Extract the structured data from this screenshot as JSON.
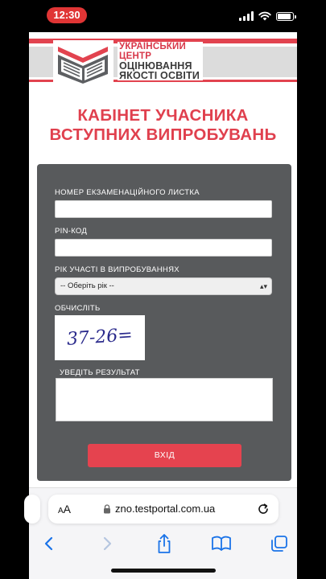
{
  "status_bar": {
    "time": "12:30"
  },
  "logo": {
    "line1": "УКРАЇНСЬКИЙ",
    "line2": "ЦЕНТР",
    "line3": "ОЦІНЮВАННЯ",
    "line4": "ЯКОСТІ ОСВІТИ"
  },
  "page_title": {
    "line1": "КАБІНЕТ УЧАСНИКА",
    "line2": "ВСТУПНИХ ВИПРОБУВАНЬ"
  },
  "form": {
    "exam_sheet_label": "НОМЕР ЕКЗАМЕНАЦІЙНОГО ЛИСТКА",
    "exam_sheet_value": "",
    "pin_label": "PIN-КОД",
    "pin_value": "",
    "year_label": "РІК УЧАСТІ В ВИПРОБУВАННЯХ",
    "year_selected": "-- Оберіть рік --",
    "captcha_label": "ОБЧИСЛІТЬ",
    "captcha_text": "37-26=",
    "result_label": "УВЕДІТЬ РЕЗУЛЬТАТ",
    "result_value": "",
    "submit_label": "ВХІД"
  },
  "browser": {
    "aa_label_small": "A",
    "aa_label_large": "A",
    "url": "zno.testportal.com.ua"
  },
  "colors": {
    "brand_red": "#e2434f",
    "form_bg": "#585a5c",
    "status_time_bg": "#e03535",
    "safari_blue": "#1a73e8"
  }
}
